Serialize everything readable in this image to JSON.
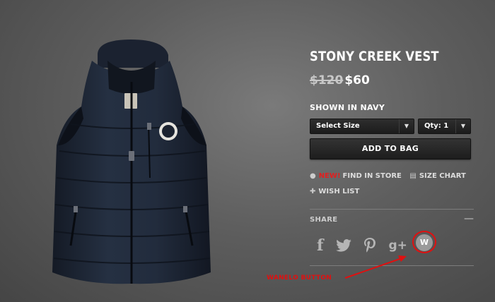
{
  "product": {
    "title": "STONY CREEK VEST",
    "price_original": "$120",
    "price_sale": "$60",
    "color_label": "SHOWN IN NAVY",
    "image_icon": "navy-puffer-vest",
    "vest_color": "#1f2633"
  },
  "options": {
    "size_select": "Select Size",
    "qty_select": "Qty: 1",
    "caret": "▼"
  },
  "actions": {
    "add_to_bag": "ADD TO BAG",
    "new_tag": "NEW!",
    "find_in_store": "FIND IN STORE",
    "size_chart": "SIZE CHART",
    "wish_list": "WISH LIST"
  },
  "share": {
    "label": "SHARE",
    "toggle": "—",
    "facebook": "f",
    "gplus": "g+",
    "wanelo": "W",
    "icons": [
      "facebook-icon",
      "twitter-icon",
      "pinterest-icon",
      "google-plus-icon",
      "wanelo-icon"
    ]
  },
  "annotation": {
    "text": "WANELO BUTTON",
    "color": "#e01010"
  }
}
